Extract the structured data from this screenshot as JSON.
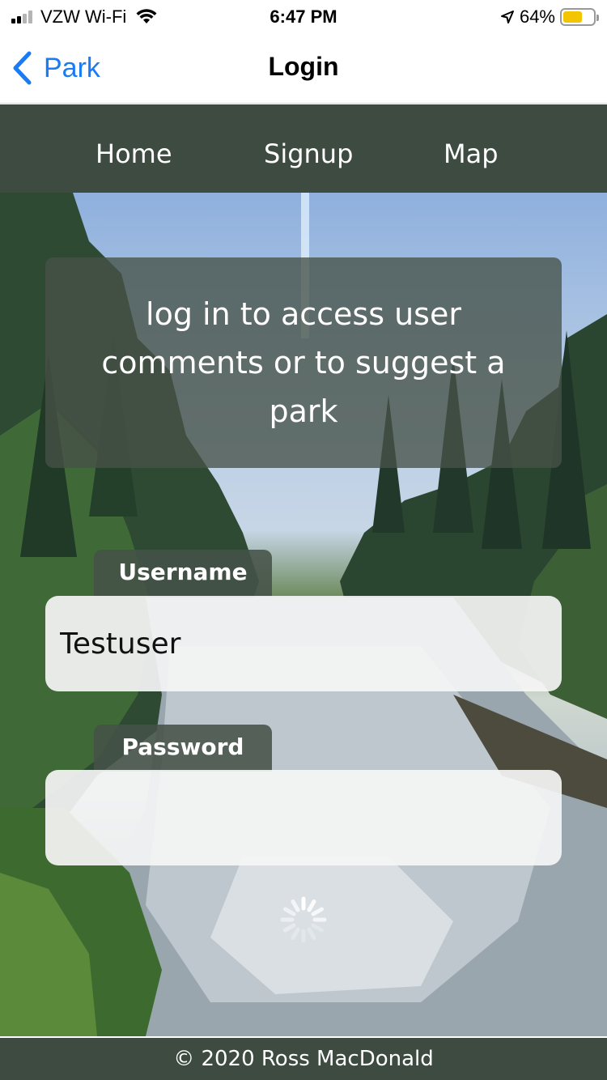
{
  "status_bar": {
    "carrier": "VZW Wi-Fi",
    "time": "6:47 PM",
    "battery_percent": "64%",
    "battery_level": 0.64,
    "signal_bars": 2,
    "icons": [
      "signal-icon",
      "wifi-icon",
      "location-arrow-icon",
      "battery-icon"
    ]
  },
  "nav_bar": {
    "back_label": "Park",
    "title": "Login"
  },
  "site_nav": {
    "items": [
      {
        "label": "Home"
      },
      {
        "label": "Signup"
      },
      {
        "label": "Map"
      }
    ]
  },
  "intro": {
    "text": "log in to access user comments or to suggest a park"
  },
  "form": {
    "username_label": "Username",
    "username_value": "Testuser",
    "password_label": "Password",
    "password_value": ""
  },
  "footer": {
    "text": "© 2020 Ross MacDonald"
  },
  "colors": {
    "nav_background": "#3d4b40",
    "ios_blue": "#1a7cf5",
    "battery_yellow": "#f2c500",
    "panel_overlay": "#465248"
  }
}
